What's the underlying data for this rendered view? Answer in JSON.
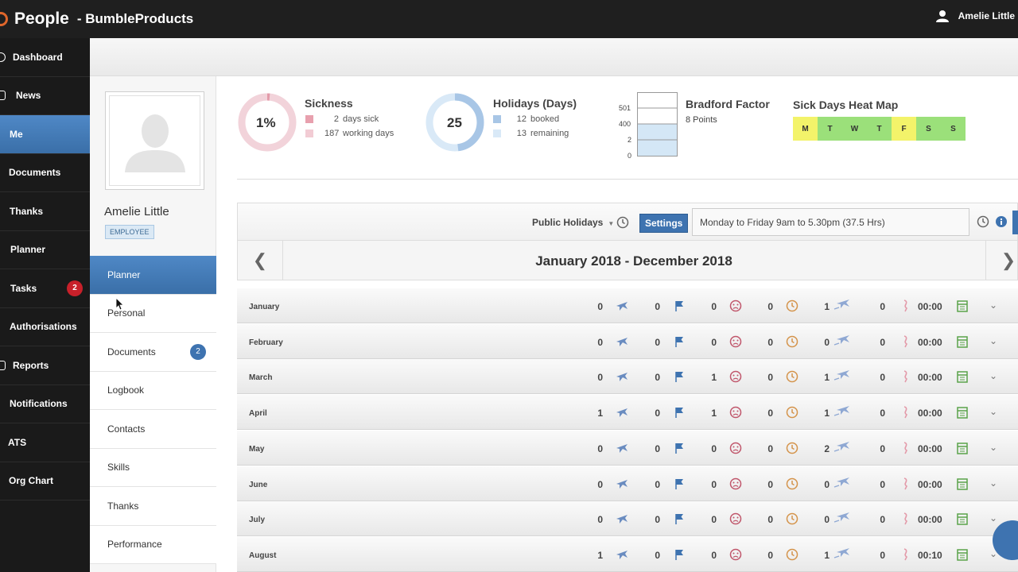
{
  "header": {
    "app_title": "People",
    "company": "- BumbleProducts",
    "user_name": "Amelie Little"
  },
  "nav": {
    "items": [
      {
        "label": "Dashboard"
      },
      {
        "label": "News"
      },
      {
        "label": "Me"
      },
      {
        "label": "Documents"
      },
      {
        "label": "Thanks"
      },
      {
        "label": "Planner"
      },
      {
        "label": "Tasks",
        "badge": "2"
      },
      {
        "label": "Authorisations"
      },
      {
        "label": "Reports"
      },
      {
        "label": "Notifications"
      },
      {
        "label": "ATS"
      },
      {
        "label": "Org Chart"
      }
    ]
  },
  "profile": {
    "name": "Amelie Little",
    "role": "EMPLOYEE",
    "menu": [
      {
        "label": "Planner"
      },
      {
        "label": "Personal"
      },
      {
        "label": "Documents",
        "badge": "2"
      },
      {
        "label": "Logbook"
      },
      {
        "label": "Contacts"
      },
      {
        "label": "Skills"
      },
      {
        "label": "Thanks"
      },
      {
        "label": "Performance"
      }
    ]
  },
  "sickness": {
    "title": "Sickness",
    "percent_label": "1%",
    "percent": 1,
    "sick_days": "2",
    "sick_days_label": "days sick",
    "working_days": "187",
    "working_days_label": "working days",
    "colors": {
      "sick": "#e8a0ae",
      "working": "#f2ccd4"
    }
  },
  "holidays": {
    "title": "Holidays (Days)",
    "total": "25",
    "booked": "12",
    "booked_label": "booked",
    "remaining": "13",
    "remaining_label": "remaining",
    "booked_fraction": 0.48,
    "colors": {
      "booked": "#a8c6e6",
      "remaining": "#d9e9f7"
    }
  },
  "bradford": {
    "title": "Bradford Factor",
    "points": "8 Points",
    "axis": [
      "501",
      "400",
      "2",
      "0"
    ]
  },
  "heatmap": {
    "title": "Sick Days Heat Map",
    "days": [
      {
        "label": "M",
        "color": "#f3f36a"
      },
      {
        "label": "T",
        "color": "#9be07a"
      },
      {
        "label": "W",
        "color": "#9be07a"
      },
      {
        "label": "T",
        "color": "#9be07a"
      },
      {
        "label": "F",
        "color": "#f3f36a"
      },
      {
        "label": "S",
        "color": "#9be07a"
      },
      {
        "label": "S",
        "color": "#9be07a"
      }
    ]
  },
  "toolbar": {
    "public_holidays": "Public Holidays",
    "settings": "Settings",
    "hours_value": "Monday to Friday 9am to 5.30pm (37.5 Hrs)"
  },
  "planner": {
    "range": "January 2018 - December 2018",
    "months": [
      {
        "name": "January",
        "holiday": "0",
        "flag": "0",
        "sick": "0",
        "late": "0",
        "travel": "1",
        "other": "0",
        "time": "00:00"
      },
      {
        "name": "February",
        "holiday": "0",
        "flag": "0",
        "sick": "0",
        "late": "0",
        "travel": "0",
        "other": "0",
        "time": "00:00"
      },
      {
        "name": "March",
        "holiday": "0",
        "flag": "0",
        "sick": "1",
        "late": "0",
        "travel": "1",
        "other": "0",
        "time": "00:00"
      },
      {
        "name": "April",
        "holiday": "1",
        "flag": "0",
        "sick": "1",
        "late": "0",
        "travel": "1",
        "other": "0",
        "time": "00:00"
      },
      {
        "name": "May",
        "holiday": "0",
        "flag": "0",
        "sick": "0",
        "late": "0",
        "travel": "2",
        "other": "0",
        "time": "00:00"
      },
      {
        "name": "June",
        "holiday": "0",
        "flag": "0",
        "sick": "0",
        "late": "0",
        "travel": "0",
        "other": "0",
        "time": "00:00"
      },
      {
        "name": "July",
        "holiday": "0",
        "flag": "0",
        "sick": "0",
        "late": "0",
        "travel": "0",
        "other": "0",
        "time": "00:00"
      },
      {
        "name": "August",
        "holiday": "1",
        "flag": "0",
        "sick": "0",
        "late": "0",
        "travel": "1",
        "other": "0",
        "time": "00:10"
      }
    ]
  }
}
